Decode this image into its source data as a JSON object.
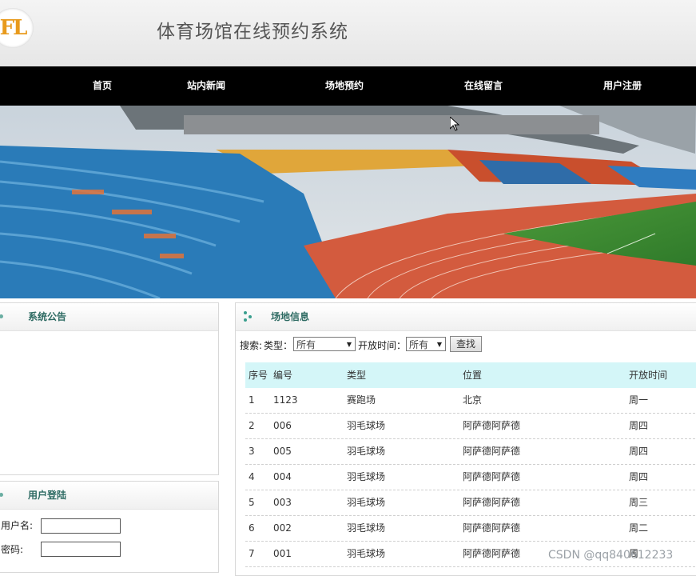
{
  "header": {
    "logo_text": "FL",
    "site_title": "体育场馆在线预约系统"
  },
  "nav": {
    "items": [
      {
        "label": "首页"
      },
      {
        "label": "站内新闻"
      },
      {
        "label": "场地预约"
      },
      {
        "label": "在线留言"
      },
      {
        "label": "用户注册"
      }
    ]
  },
  "banner": {
    "icon": "stadium-photo"
  },
  "notice_panel": {
    "title": "系统公告"
  },
  "login_panel": {
    "title": "用户登陆",
    "username_label": "用户名:",
    "password_label": "密码:",
    "username_value": "",
    "password_value": ""
  },
  "venue_panel": {
    "title": "场地信息",
    "search_label": "搜索:",
    "type_label": "类型：",
    "type_selected": "所有",
    "time_label": "开放时间：",
    "time_selected": "所有",
    "search_button": "查找",
    "columns": [
      "序号",
      "编号",
      "类型",
      "位置",
      "开放时间"
    ],
    "rows": [
      [
        "1",
        "1123",
        "赛跑场",
        "北京",
        "周一"
      ],
      [
        "2",
        "006",
        "羽毛球场",
        "阿萨德阿萨德",
        "周四"
      ],
      [
        "3",
        "005",
        "羽毛球场",
        "阿萨德阿萨德",
        "周四"
      ],
      [
        "4",
        "004",
        "羽毛球场",
        "阿萨德阿萨德",
        "周四"
      ],
      [
        "5",
        "003",
        "羽毛球场",
        "阿萨德阿萨德",
        "周三"
      ],
      [
        "6",
        "002",
        "羽毛球场",
        "阿萨德阿萨德",
        "周二"
      ],
      [
        "7",
        "001",
        "羽毛球场",
        "阿萨德阿萨德",
        "周"
      ]
    ]
  },
  "watermark": "CSDN @qq840612233",
  "colors": {
    "nav_bg": "#000000",
    "panel_title": "#2e6b63",
    "table_header_bg": "#d4f6f8",
    "logo_orange": "#e89a1c"
  }
}
